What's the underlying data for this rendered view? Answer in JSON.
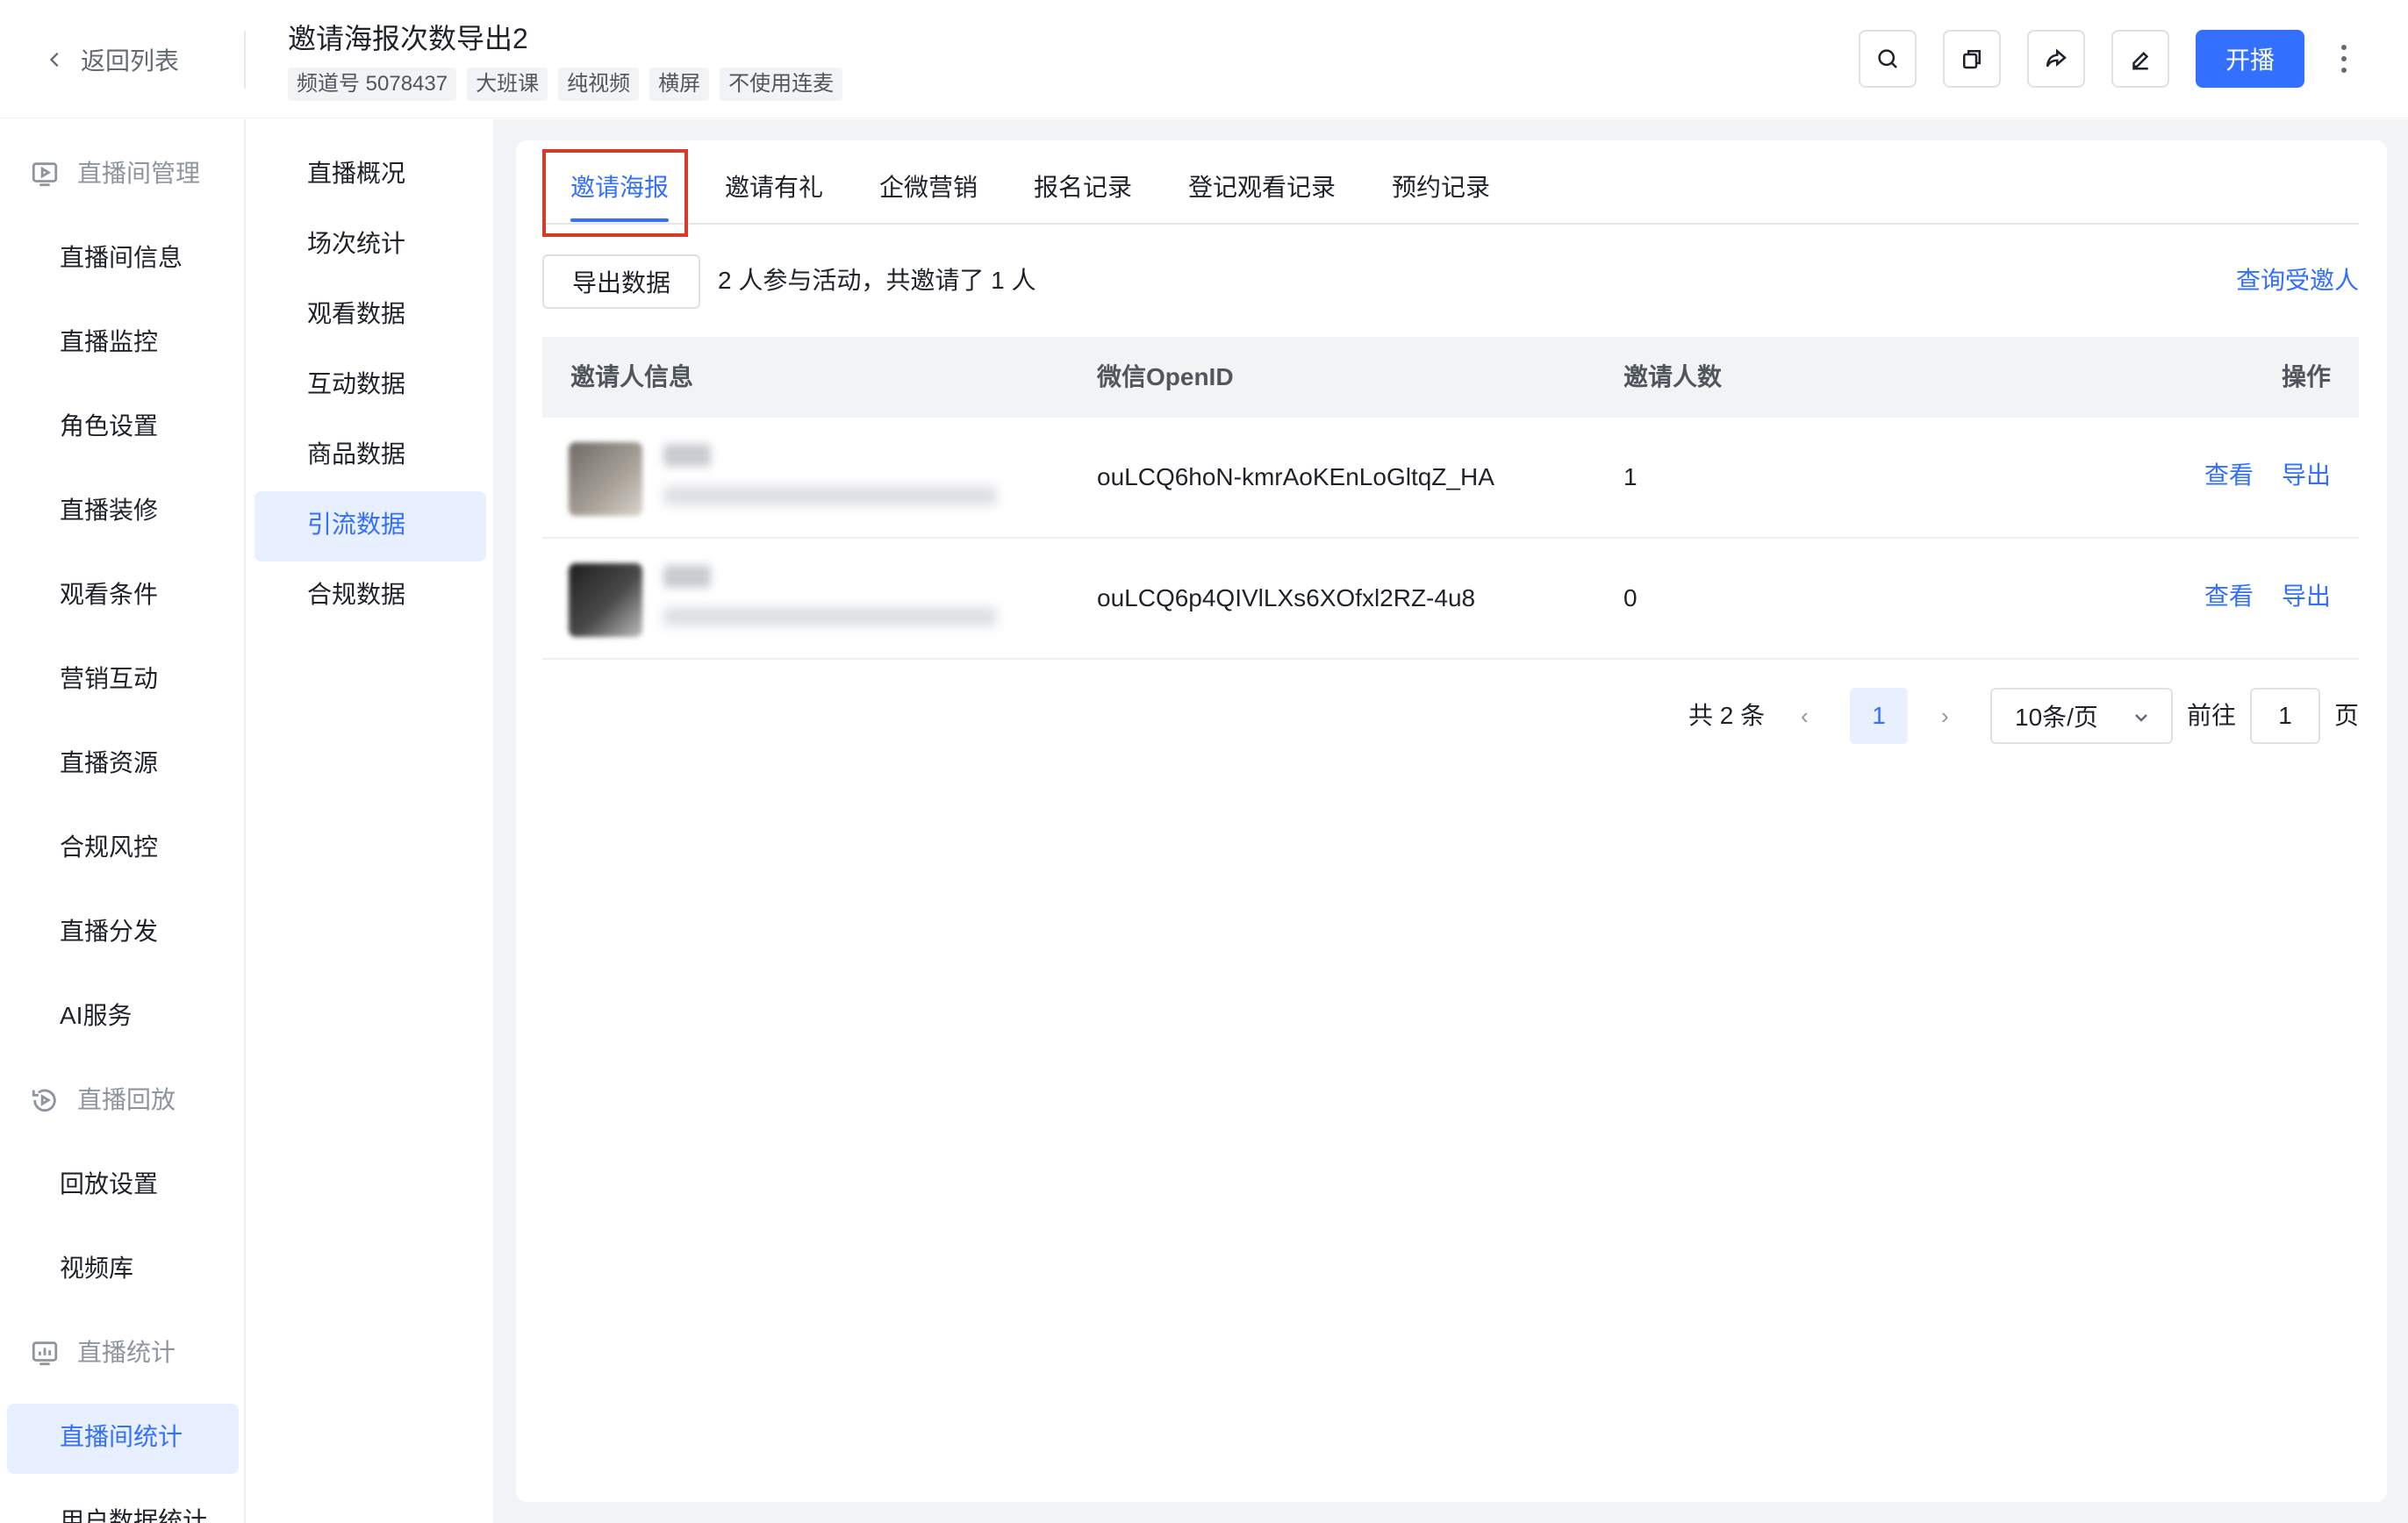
{
  "header": {
    "back_label": "返回列表",
    "title": "邀请海报次数导出2",
    "tags": [
      "频道号 5078437",
      "大班课",
      "纯视频",
      "横屏",
      "不使用连麦"
    ],
    "start_label": "开播",
    "icons": [
      "search-icon",
      "copy-icon",
      "share-icon",
      "edit-icon",
      "more-icon"
    ]
  },
  "sidebar": {
    "groups": {
      "live_room_mgmt": "直播间管理",
      "replay": "直播回放",
      "stats": "直播统计"
    },
    "items": [
      "直播间信息",
      "直播监控",
      "角色设置",
      "直播装修",
      "观看条件",
      "营销互动",
      "直播资源",
      "合规风控",
      "直播分发",
      "AI服务"
    ],
    "replay_items": [
      "回放设置",
      "视频库"
    ],
    "stats_items": [
      "直播间统计",
      "用户数据统计"
    ],
    "active": "直播间统计"
  },
  "subnav": {
    "items": [
      "直播概况",
      "场次统计",
      "观看数据",
      "互动数据",
      "商品数据",
      "引流数据",
      "合规数据"
    ],
    "active": "引流数据"
  },
  "tabs": {
    "items": [
      "邀请海报",
      "邀请有礼",
      "企微营销",
      "报名记录",
      "登记观看记录",
      "预约记录"
    ],
    "active": "邀请海报"
  },
  "toolbar": {
    "export_label": "导出数据",
    "summary": "2 人参与活动，共邀请了 1 人",
    "query_invitee": "查询受邀人"
  },
  "table": {
    "columns": [
      "邀请人信息",
      "微信OpenID",
      "邀请人数",
      "操作"
    ],
    "rows": [
      {
        "openid": "ouLCQ6hoN-kmrAoKEnLoGltqZ_HA",
        "count": "1",
        "view": "查看",
        "export": "导出"
      },
      {
        "openid": "ouLCQ6p4QIVlLXs6XOfxl2RZ-4u8",
        "count": "0",
        "view": "查看",
        "export": "导出"
      }
    ]
  },
  "pagination": {
    "total": "共 2 条",
    "prev": "‹",
    "current": "1",
    "next": "›",
    "page_size": "10条/页",
    "goto_label": "前往",
    "goto_value": "1",
    "page_unit": "页"
  },
  "colors": {
    "primary": "#3370ff",
    "highlight_box": "#d93a2b",
    "content_bg": "#f2f3f5"
  }
}
